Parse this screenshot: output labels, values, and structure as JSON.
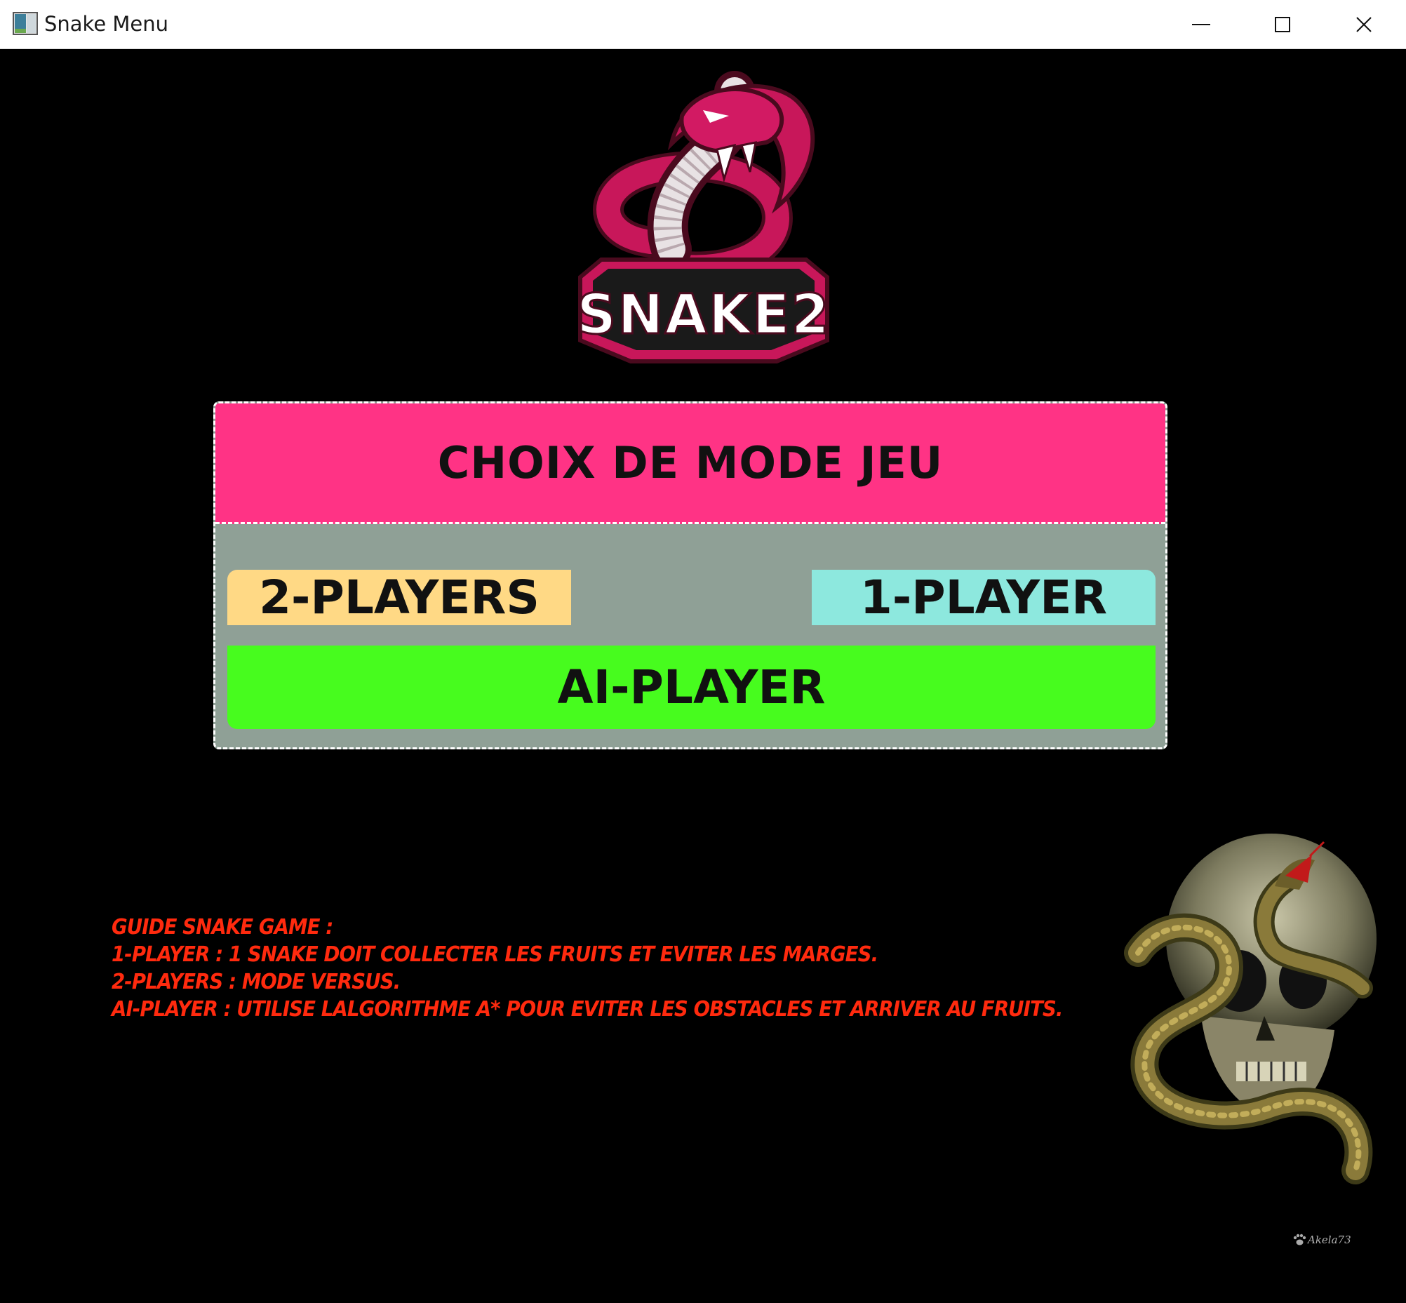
{
  "window": {
    "title": "Snake Menu"
  },
  "logo": {
    "text": "SNAKE2"
  },
  "menu": {
    "title": "CHOIX DE MODE JEU",
    "buttons": {
      "two_players": "2-PLAYERS",
      "one_player": "1-PLAYER",
      "ai_player": "AI-PLAYER"
    }
  },
  "guide": {
    "lines": [
      "GUIDE SNAKE GAME :",
      "1-PLAYER : 1 SNAKE DOIT COLLECTER LES FRUITS ET EVITER LES MARGES.",
      "2-PLAYERS : MODE VERSUS.",
      "AI-PLAYER : UTILISE LALGORITHME A* POUR EVITER LES OBSTACLES ET ARRIVER AU FRUITS."
    ]
  },
  "art": {
    "signature": "Akela73"
  },
  "colors": {
    "header": "#ff3385",
    "panel": "#8fa096",
    "two_players": "#ffd985",
    "one_player": "#8de8de",
    "ai_player": "#47fc1e",
    "guide_text": "#ff2a0e"
  },
  "icons": [
    "app-icon",
    "minimize-icon",
    "maximize-icon",
    "close-icon",
    "snake-logo",
    "skull-snake-art",
    "paw-icon"
  ]
}
